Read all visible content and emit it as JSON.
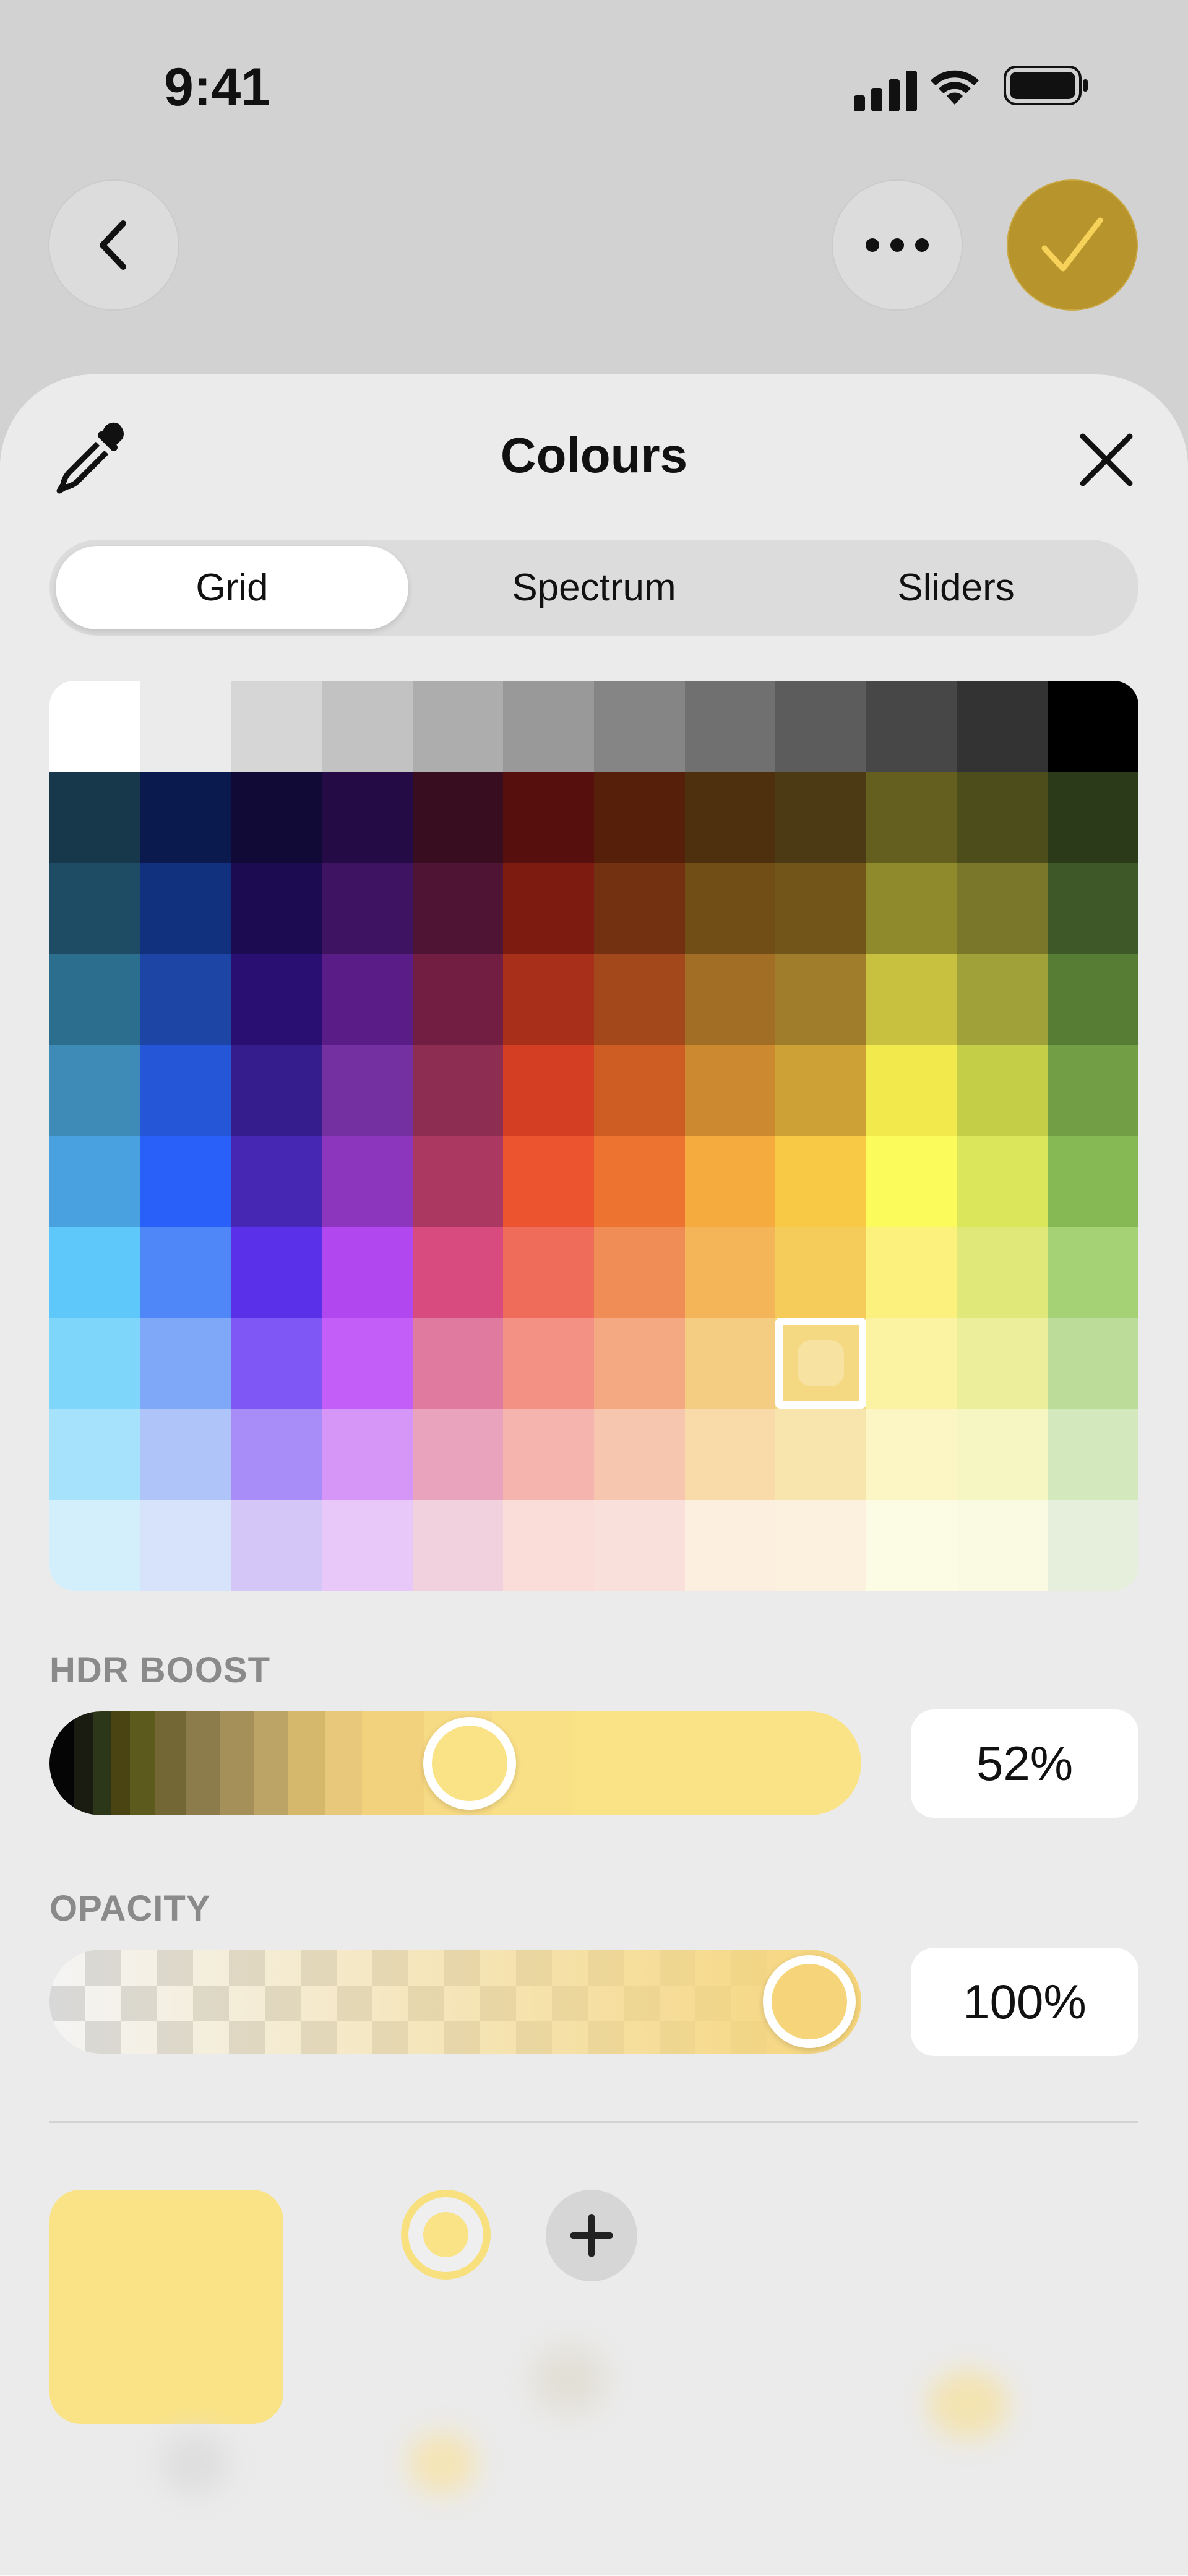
{
  "status_bar": {
    "time": "9:41",
    "icons": [
      "signal-icon",
      "wifi-icon",
      "battery-icon"
    ]
  },
  "nav": {
    "back_icon": "chevron-left-icon",
    "more_icon": "ellipsis-icon",
    "confirm_icon": "checkmark-icon",
    "confirm_color": "#b8942c"
  },
  "sheet": {
    "title": "Colours",
    "eyedropper_icon": "eyedropper-icon",
    "close_icon": "close-icon",
    "tabs": [
      {
        "label": "Grid",
        "active": true
      },
      {
        "label": "Spectrum",
        "active": false
      },
      {
        "label": "Sliders",
        "active": false
      }
    ]
  },
  "grid": {
    "selected": {
      "row": 7,
      "col": 8
    },
    "rows": [
      [
        "#ffffff",
        "#ebebeb",
        "#d6d6d6",
        "#c2c2c2",
        "#adadad",
        "#999999",
        "#858585",
        "#707070",
        "#5c5c5c",
        "#474747",
        "#333333",
        "#000000"
      ],
      [
        "#16384a",
        "#0b1a4e",
        "#110a36",
        "#240b45",
        "#380d20",
        "#560f0c",
        "#551f0a",
        "#4f300e",
        "#4b3a14",
        "#645e1f",
        "#4d4d1c",
        "#2b3b1a"
      ],
      [
        "#1e4c65",
        "#11307e",
        "#1d0b52",
        "#3e1362",
        "#4f1433",
        "#7d1b10",
        "#733112",
        "#714e16",
        "#715519",
        "#8f8a2c",
        "#7b772a",
        "#3f5827"
      ],
      [
        "#2c6e8e",
        "#1c45a6",
        "#280f71",
        "#5a1c87",
        "#721e42",
        "#a8301b",
        "#a3481b",
        "#a26d25",
        "#a07d2a",
        "#c8c03f",
        "#a1a13a",
        "#577c34"
      ],
      [
        "#3e8bb7",
        "#2556d7",
        "#361d8e",
        "#742fa1",
        "#8c2d51",
        "#d43e22",
        "#ce5d24",
        "#cc8930",
        "#cda136",
        "#f2ea4d",
        "#c5ce47",
        "#729e46"
      ],
      [
        "#49a2df",
        "#2a60fa",
        "#4627b3",
        "#8b36bd",
        "#aa3861",
        "#ec532f",
        "#ed7430",
        "#f5ab3e",
        "#f7c945",
        "#fcfb5c",
        "#dbe65a",
        "#86b954"
      ],
      [
        "#5ec8fa",
        "#4f86f8",
        "#5a31e8",
        "#b147ee",
        "#d74b7e",
        "#ef6b5a",
        "#f08c56",
        "#f4b458",
        "#f5cc5a",
        "#fcf17c",
        "#e1e87a",
        "#a4d274"
      ],
      [
        "#7ed6fa",
        "#7fa8f9",
        "#7e57f4",
        "#c35ff8",
        "#e07a9e",
        "#f39185",
        "#f5a983",
        "#f5cd82",
        "#f5d882",
        "#fbf3a1",
        "#ecee9c",
        "#bcdd99"
      ],
      [
        "#a6e2fb",
        "#afc5fa",
        "#a88cf7",
        "#d696f8",
        "#eaa3bd",
        "#f6b4ae",
        "#f6c7ae",
        "#f9dbaa",
        "#f8e4ad",
        "#fbf6c3",
        "#f5f6c2",
        "#d4e8bd"
      ],
      [
        "#d2effb",
        "#d7e3fb",
        "#d4c7f8",
        "#e8c8f9",
        "#f2d1de",
        "#fadcd9",
        "#fae0da",
        "#fcefdf",
        "#fbf1de",
        "#fcfbe3",
        "#fafae2",
        "#e5efdb"
      ]
    ]
  },
  "hdr": {
    "label": "HDR BOOST",
    "value_text": "52%",
    "value": 0.52
  },
  "opacity": {
    "label": "OPACITY",
    "value_text": "100%",
    "value": 1.0
  },
  "swatches": {
    "current_color": "#fae387",
    "add_icon": "plus-icon"
  },
  "colors": {
    "accent": "#b8942c",
    "selected": "#fae387"
  }
}
